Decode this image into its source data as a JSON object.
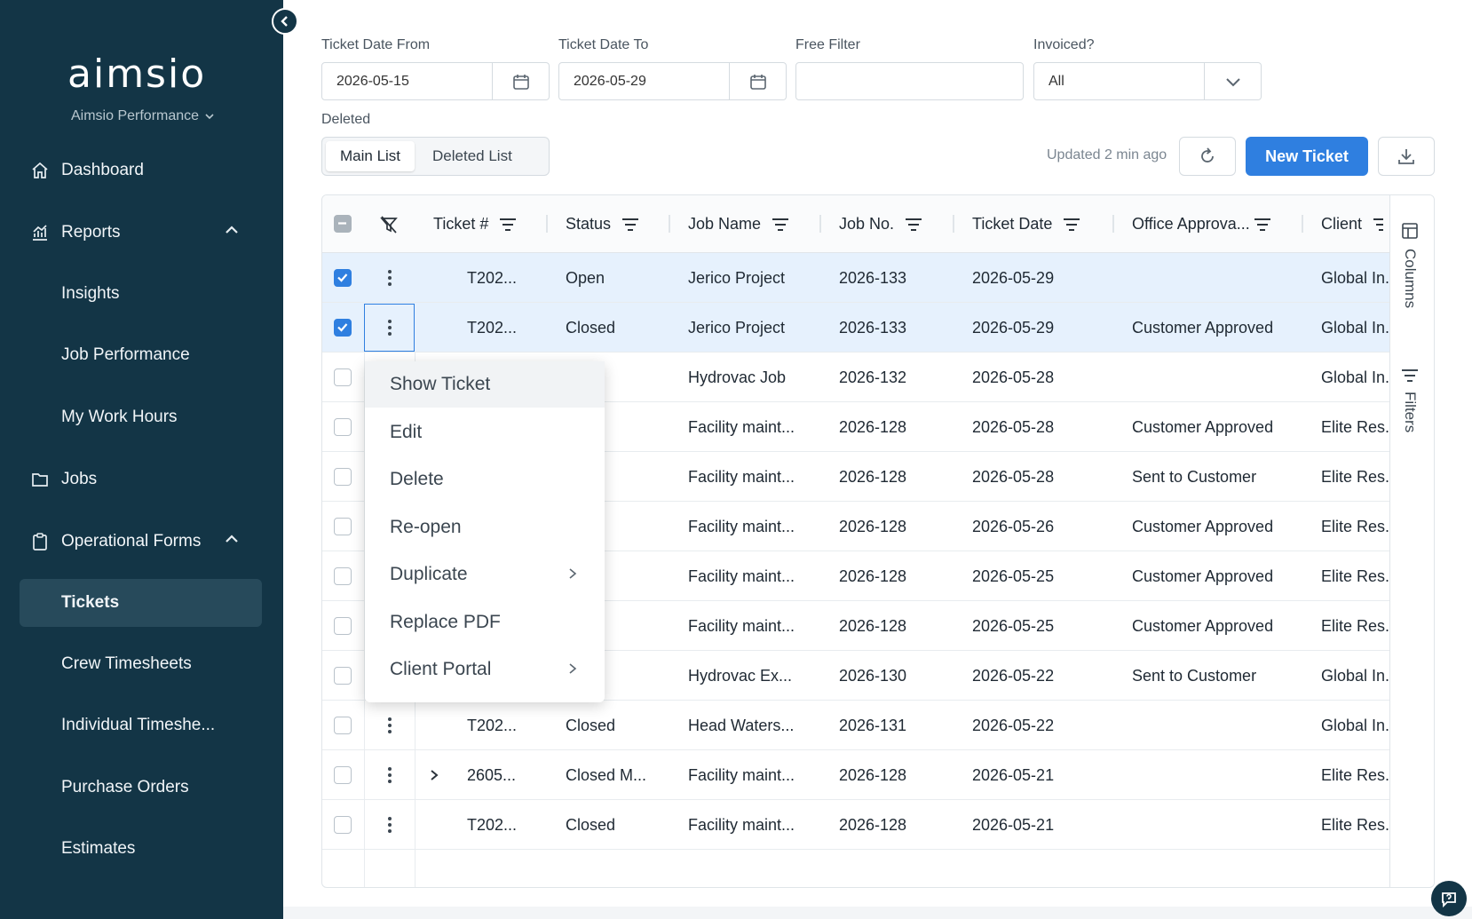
{
  "sidebar": {
    "logo": "aimsio",
    "org": "Aimsio Performance",
    "items": {
      "dashboard": "Dashboard",
      "reports": "Reports",
      "insights": "Insights",
      "job_performance": "Job Performance",
      "my_work_hours": "My Work Hours",
      "jobs": "Jobs",
      "operational_forms": "Operational Forms",
      "tickets": "Tickets",
      "crew_timesheets": "Crew Timesheets",
      "individual_timesheets": "Individual Timeshe...",
      "purchase_orders": "Purchase Orders",
      "estimates": "Estimates"
    }
  },
  "filters": {
    "date_from_label": "Ticket Date From",
    "date_from_value": "2026-05-15",
    "date_to_label": "Ticket Date To",
    "date_to_value": "2026-05-29",
    "free_filter_label": "Free Filter",
    "free_filter_value": "",
    "invoiced_label": "Invoiced?",
    "invoiced_value": "All",
    "deleted_label": "Deleted"
  },
  "toolbar": {
    "main_list": "Main List",
    "deleted_list": "Deleted List",
    "updated": "Updated 2 min ago",
    "new_ticket": "New Ticket"
  },
  "table": {
    "headers": {
      "ticket": "Ticket #",
      "status": "Status",
      "job_name": "Job Name",
      "job_no": "Job No.",
      "ticket_date": "Ticket Date",
      "office_approval": "Office Approva...",
      "client": "Client"
    },
    "rows": [
      {
        "ticket": "T202...",
        "status": "Open",
        "job_name": "Jerico Project",
        "job_no": "2026-133",
        "ticket_date": "2026-05-29",
        "office_approval": "",
        "client": "Global In...",
        "checked": true
      },
      {
        "ticket": "T202...",
        "status": "Closed",
        "job_name": "Jerico Project",
        "job_no": "2026-133",
        "ticket_date": "2026-05-29",
        "office_approval": "Customer Approved",
        "client": "Global In...",
        "checked": true
      },
      {
        "ticket": "",
        "status": "ed",
        "job_name": "Hydrovac Job",
        "job_no": "2026-132",
        "ticket_date": "2026-05-28",
        "office_approval": "",
        "client": "Global In...",
        "checked": false
      },
      {
        "ticket": "",
        "status": "ed",
        "job_name": "Facility maint...",
        "job_no": "2026-128",
        "ticket_date": "2026-05-28",
        "office_approval": "Customer Approved",
        "client": "Elite Res...",
        "checked": false
      },
      {
        "ticket": "",
        "status": "ed",
        "job_name": "Facility maint...",
        "job_no": "2026-128",
        "ticket_date": "2026-05-28",
        "office_approval": "Sent to Customer",
        "client": "Elite Res...",
        "checked": false
      },
      {
        "ticket": "",
        "status": "ed",
        "job_name": "Facility maint...",
        "job_no": "2026-128",
        "ticket_date": "2026-05-26",
        "office_approval": "Customer Approved",
        "client": "Elite Res...",
        "checked": false
      },
      {
        "ticket": "",
        "status": "ed",
        "job_name": "Facility maint...",
        "job_no": "2026-128",
        "ticket_date": "2026-05-25",
        "office_approval": "Customer Approved",
        "client": "Elite Res...",
        "checked": false
      },
      {
        "ticket": "",
        "status": "ed",
        "job_name": "Facility maint...",
        "job_no": "2026-128",
        "ticket_date": "2026-05-25",
        "office_approval": "Customer Approved",
        "client": "Elite Res...",
        "checked": false
      },
      {
        "ticket": "",
        "status": "ed",
        "job_name": "Hydrovac Ex...",
        "job_no": "2026-130",
        "ticket_date": "2026-05-22",
        "office_approval": "Sent to Customer",
        "client": "Global In...",
        "checked": false
      },
      {
        "ticket": "T202...",
        "status": "Closed",
        "job_name": "Head Waters...",
        "job_no": "2026-131",
        "ticket_date": "2026-05-22",
        "office_approval": "",
        "client": "Global In...",
        "checked": false
      },
      {
        "ticket": "2605...",
        "status": "Closed M...",
        "job_name": "Facility maint...",
        "job_no": "2026-128",
        "ticket_date": "2026-05-21",
        "office_approval": "",
        "client": "Elite Res...",
        "checked": false
      },
      {
        "ticket": "T202...",
        "status": "Closed",
        "job_name": "Facility maint...",
        "job_no": "2026-128",
        "ticket_date": "2026-05-21",
        "office_approval": "",
        "client": "Elite Res...",
        "checked": false
      }
    ]
  },
  "side_panel": {
    "columns": "Columns",
    "filters": "Filters"
  },
  "context_menu": {
    "show_ticket": "Show Ticket",
    "edit": "Edit",
    "delete": "Delete",
    "reopen": "Re-open",
    "duplicate": "Duplicate",
    "replace_pdf": "Replace PDF",
    "client_portal": "Client Portal"
  },
  "colors": {
    "sidebar_bg": "#133546",
    "accent": "#2f7fe0",
    "selected_row": "#e6f1fd"
  }
}
